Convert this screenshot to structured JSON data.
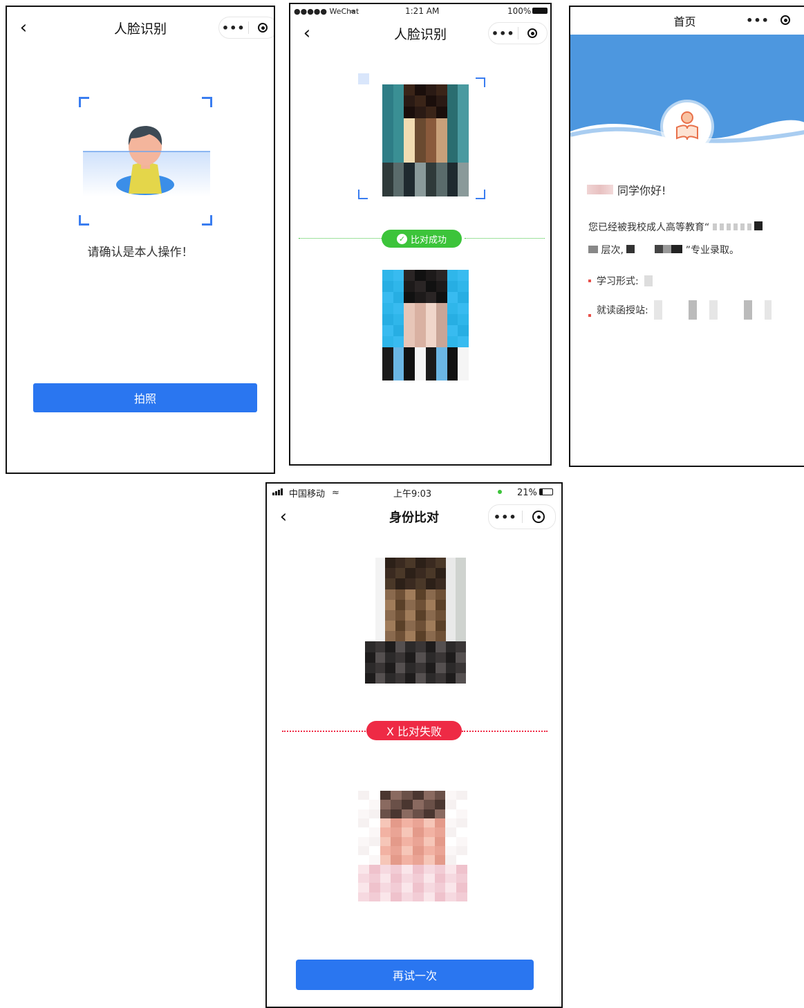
{
  "panel1": {
    "title": "人脸识别",
    "prompt": "请确认是本人操作！",
    "button_label": "拍照",
    "menu_dots": "•••"
  },
  "panel2": {
    "status": {
      "carrier": "●●●●● WeChat",
      "time": "1:21 AM",
      "battery": "100%"
    },
    "title": "人脸识别",
    "result_label": "比对成功",
    "menu_dots": "•••"
  },
  "panel3": {
    "title": "首页",
    "greeting": "同学你好!",
    "message_line1": "您已经被我校成人高等教育“",
    "message_line2_a": "层次,",
    "message_line2_b": "”专业录取。",
    "field1_label": "学习形式:",
    "field2_label": "就读函授站:",
    "menu_dots": "•••"
  },
  "panel4": {
    "status": {
      "carrier": "中国移动",
      "time": "上午9:03",
      "battery": "21%"
    },
    "title": "身份比对",
    "result_label": "X 比对失败",
    "button_label": "再试一次",
    "menu_dots": "•••"
  },
  "colors": {
    "primary_blue": "#2a76f0",
    "success_green": "#3cc43a",
    "fail_red": "#ee2a45",
    "header_blue": "#4d97df"
  },
  "icons": [
    "back-arrow-icon",
    "more-dots-icon",
    "target-icon",
    "check-icon",
    "reader-avatar-icon",
    "wifi-icon",
    "signal-icon",
    "battery-icon"
  ]
}
